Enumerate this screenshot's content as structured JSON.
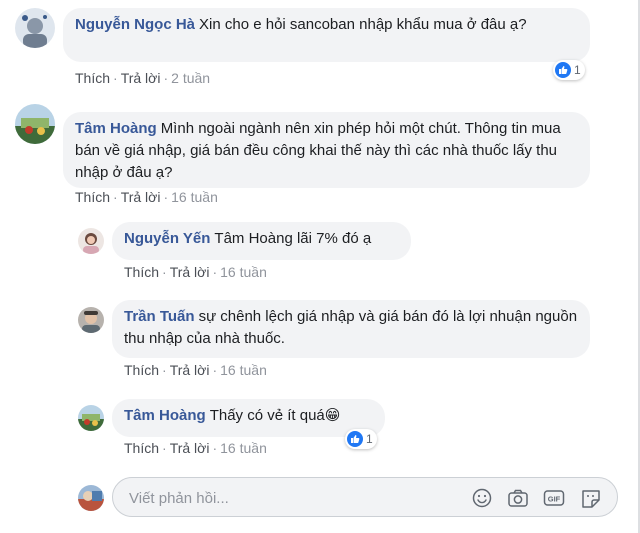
{
  "comments": [
    {
      "author": "Nguyễn Ngọc Hà",
      "text": "Xin cho e hỏi sancoban nhập khẩu mua ở đâu ạ?",
      "like": "Thích",
      "reply": "Trả lời",
      "time": "2 tuần",
      "reaction_count": "1"
    },
    {
      "author": "Tâm Hoàng",
      "text": "Mình ngoài ngành nên xin phép hỏi một chút. Thông tin mua bán về giá nhập, giá bán đều công khai thế này thì các nhà thuốc lấy thu nhập ở đâu ạ?",
      "like": "Thích",
      "reply": "Trả lời",
      "time": "16 tuần"
    }
  ],
  "replies": [
    {
      "author": "Nguyễn Yến",
      "text": "Tâm Hoàng lãi 7% đó ạ",
      "like": "Thích",
      "reply": "Trả lời",
      "time": "16 tuần"
    },
    {
      "author": "Trần Tuấn",
      "text": "sự chênh lệch giá nhập và giá bán đó là lợi nhuận nguồn thu nhập của nhà thuốc.",
      "like": "Thích",
      "reply": "Trả lời",
      "time": "16 tuần"
    },
    {
      "author": "Tâm Hoàng",
      "text": "Thấy có vẻ ít quá",
      "emoji": "😁",
      "like": "Thích",
      "reply": "Trả lời",
      "time": "16 tuần",
      "reaction_count": "1"
    }
  ],
  "reply_input": {
    "placeholder": "Viết phản hồi..."
  },
  "icons": [
    "emoji-icon",
    "camera-icon",
    "gif-icon",
    "sticker-icon",
    "like-icon"
  ],
  "colors": {
    "author": "#385898",
    "bubble": "#f2f3f5",
    "like_blue": "#2078f4",
    "meta": "#90949c"
  }
}
